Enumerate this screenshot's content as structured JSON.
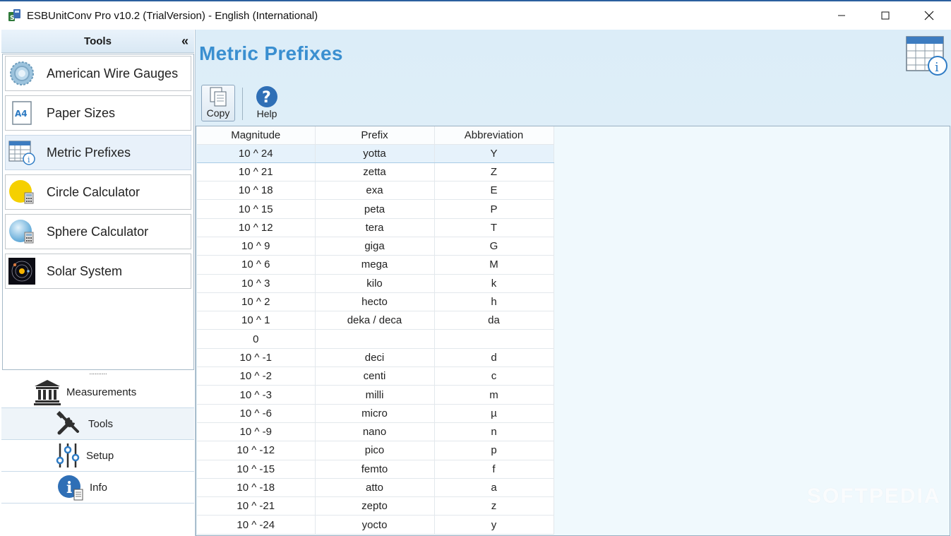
{
  "window": {
    "title": "ESBUnitConv Pro v10.2 (TrialVersion) - English (International)",
    "minimize_icon": "minimize-icon",
    "maximize_icon": "maximize-icon",
    "close_icon": "close-icon"
  },
  "sidebar": {
    "header": "Tools",
    "collapse_label": "«",
    "tools": [
      {
        "label": "American Wire Gauges",
        "icon": "wire-gauge-icon"
      },
      {
        "label": "Paper Sizes",
        "icon": "a4-paper-icon",
        "icon_text": "A4"
      },
      {
        "label": "Metric Prefixes",
        "icon": "table-info-icon",
        "selected": true
      },
      {
        "label": "Circle Calculator",
        "icon": "circle-calculator-icon"
      },
      {
        "label": "Sphere Calculator",
        "icon": "sphere-calculator-icon"
      },
      {
        "label": "Solar System",
        "icon": "solar-system-icon"
      }
    ],
    "splitter_grip": "..........",
    "nav": [
      {
        "label": "Measurements",
        "icon": "museum-icon"
      },
      {
        "label": "Tools",
        "icon": "tools-icon",
        "active": true
      },
      {
        "label": "Setup",
        "icon": "sliders-icon"
      },
      {
        "label": "Info",
        "icon": "info-icon"
      }
    ]
  },
  "main": {
    "title": "Metric Prefixes",
    "toolbar": {
      "copy_label": "Copy",
      "help_label": "Help"
    },
    "table": {
      "columns": [
        "Magnitude",
        "Prefix",
        "Abbreviation"
      ],
      "rows": [
        [
          "10 ^ 24",
          "yotta",
          "Y"
        ],
        [
          "10 ^ 21",
          "zetta",
          "Z"
        ],
        [
          "10 ^ 18",
          "exa",
          "E"
        ],
        [
          "10 ^ 15",
          "peta",
          "P"
        ],
        [
          "10 ^ 12",
          "tera",
          "T"
        ],
        [
          "10 ^ 9",
          "giga",
          "G"
        ],
        [
          "10 ^ 6",
          "mega",
          "M"
        ],
        [
          "10 ^ 3",
          "kilo",
          "k"
        ],
        [
          "10 ^ 2",
          "hecto",
          "h"
        ],
        [
          "10 ^ 1",
          "deka / deca",
          "da"
        ],
        [
          "0",
          "",
          ""
        ],
        [
          "10 ^ -1",
          "deci",
          "d"
        ],
        [
          "10 ^ -2",
          "centi",
          "c"
        ],
        [
          "10 ^ -3",
          "milli",
          "m"
        ],
        [
          "10 ^ -6",
          "micro",
          "µ"
        ],
        [
          "10 ^ -9",
          "nano",
          "n"
        ],
        [
          "10 ^ -12",
          "pico",
          "p"
        ],
        [
          "10 ^ -15",
          "femto",
          "f"
        ],
        [
          "10 ^ -18",
          "atto",
          "a"
        ],
        [
          "10 ^ -21",
          "zepto",
          "z"
        ],
        [
          "10 ^ -24",
          "yocto",
          "y"
        ]
      ],
      "selected_row": 0
    },
    "watermark": "SOFTPEDIA"
  },
  "colors": {
    "title_accent": "#3a8fd0",
    "main_bg": "#dcedf8",
    "selection": "#e6f2fb"
  }
}
